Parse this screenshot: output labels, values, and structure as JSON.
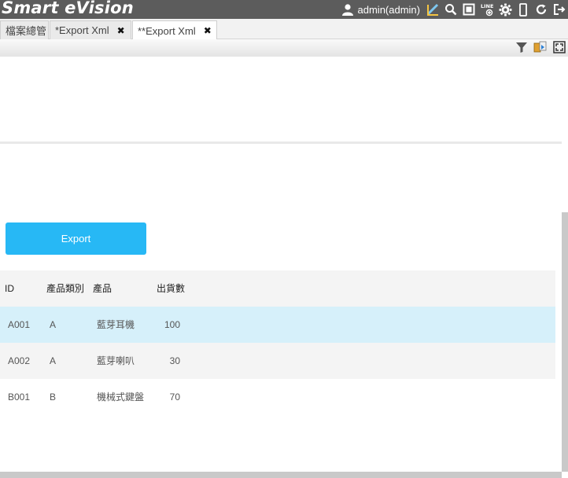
{
  "app": {
    "brand": "Smart eVision",
    "user": "admin(admin)",
    "icons": [
      "user-icon",
      "dashboard-icon",
      "search-icon",
      "fullscreen-icon",
      "line-add-icon",
      "gear-icon",
      "mobile-icon",
      "refresh-icon",
      "logout-icon"
    ]
  },
  "tabs": [
    {
      "label": "檔案總管",
      "closable": false
    },
    {
      "label": "*Export Xml",
      "closable": true,
      "close": "✖"
    },
    {
      "label": "**Export Xml",
      "closable": true,
      "close": "✖",
      "active": true
    }
  ],
  "toolbar": {
    "icons": [
      "filter-icon",
      "export-icon",
      "expand-icon"
    ]
  },
  "actions": {
    "export_label": "Export"
  },
  "grid": {
    "columns": [
      "ID",
      "產品類別",
      "產品",
      "出貨數"
    ],
    "rows": [
      {
        "id": "A001",
        "category": "A",
        "product": "藍芽耳機",
        "qty": "100"
      },
      {
        "id": "A002",
        "category": "A",
        "product": "藍芽喇叭",
        "qty": "30"
      },
      {
        "id": "B001",
        "category": "B",
        "product": "機械式鍵盤",
        "qty": "70"
      }
    ]
  },
  "colors": {
    "topbar": "#5c5c5c",
    "button": "#27b8f5",
    "selected_row": "#d6f0fa"
  }
}
